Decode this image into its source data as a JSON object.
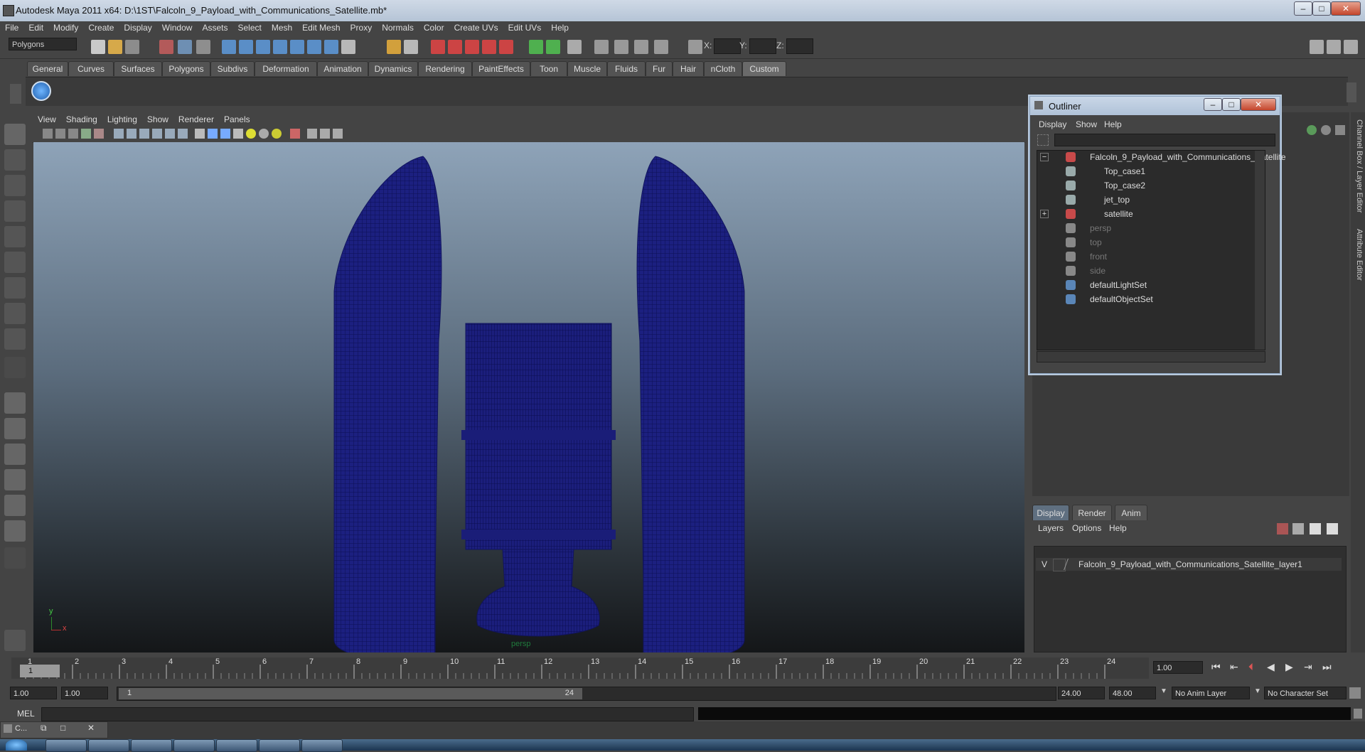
{
  "window": {
    "title": "Autodesk Maya 2011 x64: D:\\1ST\\Falcoln_9_Payload_with_Communications_Satellite.mb*",
    "minimize": "–",
    "maximize": "□",
    "close": "✕"
  },
  "menubar": [
    "File",
    "Edit",
    "Modify",
    "Create",
    "Display",
    "Window",
    "Assets",
    "Select",
    "Mesh",
    "Edit Mesh",
    "Proxy",
    "Normals",
    "Color",
    "Create UVs",
    "Edit UVs",
    "Help"
  ],
  "toolbar": {
    "mode": "Polygons",
    "x_label": "X:",
    "y_label": "Y:",
    "z_label": "Z:"
  },
  "shelf_tabs": [
    "General",
    "Curves",
    "Surfaces",
    "Polygons",
    "Subdivs",
    "Deformation",
    "Animation",
    "Dynamics",
    "Rendering",
    "PaintEffects",
    "Toon",
    "Muscle",
    "Fluids",
    "Fur",
    "Hair",
    "nCloth",
    "Custom"
  ],
  "shelf_active": "Custom",
  "viewport": {
    "menu": [
      "View",
      "Shading",
      "Lighting",
      "Show",
      "Renderer",
      "Panels"
    ],
    "camera_label": "persp",
    "axis_y": "y",
    "axis_x": "x"
  },
  "outliner": {
    "title": "Outliner",
    "menu": [
      "Display",
      "Show",
      "Help"
    ],
    "items": [
      {
        "label": "Falcoln_9_Payload_with_Communications_Satellite",
        "level": 0,
        "dim": false,
        "icon": "mesh-group-icon",
        "expander": "−"
      },
      {
        "label": "Top_case1",
        "level": 1,
        "dim": false,
        "icon": "transform-icon",
        "expander": ""
      },
      {
        "label": "Top_case2",
        "level": 1,
        "dim": false,
        "icon": "transform-icon",
        "expander": ""
      },
      {
        "label": "jet_top",
        "level": 1,
        "dim": false,
        "icon": "transform-icon",
        "expander": ""
      },
      {
        "label": "satellite",
        "level": 1,
        "dim": false,
        "icon": "mesh-group-icon",
        "expander": "+"
      },
      {
        "label": "persp",
        "level": 0,
        "dim": true,
        "icon": "camera-icon",
        "expander": ""
      },
      {
        "label": "top",
        "level": 0,
        "dim": true,
        "icon": "camera-icon",
        "expander": ""
      },
      {
        "label": "front",
        "level": 0,
        "dim": true,
        "icon": "camera-icon",
        "expander": ""
      },
      {
        "label": "side",
        "level": 0,
        "dim": true,
        "icon": "camera-icon",
        "expander": ""
      },
      {
        "label": "defaultLightSet",
        "level": 0,
        "dim": false,
        "icon": "set-icon",
        "expander": ""
      },
      {
        "label": "defaultObjectSet",
        "level": 0,
        "dim": false,
        "icon": "set-icon",
        "expander": ""
      }
    ]
  },
  "side_tabs": {
    "channel_box": "Channel Box / Layer Editor",
    "attribute_editor": "Attribute Editor"
  },
  "layer_editor": {
    "tabs": [
      "Display",
      "Render",
      "Anim"
    ],
    "active_tab": "Display",
    "menu": [
      "Layers",
      "Options",
      "Help"
    ],
    "layer_visible": "V",
    "layer_name": "Falcoln_9_Payload_with_Communications_Satellite_layer1"
  },
  "timeline": {
    "ticks": [
      "1",
      "2",
      "3",
      "4",
      "5",
      "6",
      "7",
      "8",
      "9",
      "10",
      "11",
      "12",
      "13",
      "14",
      "15",
      "16",
      "17",
      "18",
      "19",
      "20",
      "21",
      "22",
      "23",
      "24"
    ],
    "current_frame_box": "1",
    "current_time": "1.00"
  },
  "range": {
    "start": "1.00",
    "playback_start": "1.00",
    "slider_start": "1",
    "slider_end": "24",
    "playback_end": "24.00",
    "end": "48.00",
    "anim_layer": "No Anim Layer",
    "character_set": "No Character Set"
  },
  "command_line": {
    "label": "MEL"
  },
  "taskbar": {
    "minimized_label": "C..."
  },
  "colors": {
    "wireframe": "#1b1f7a",
    "viewport_top": "#8ea3b8",
    "viewport_bottom": "#141618",
    "shelf_active": "#6a6a6a"
  }
}
